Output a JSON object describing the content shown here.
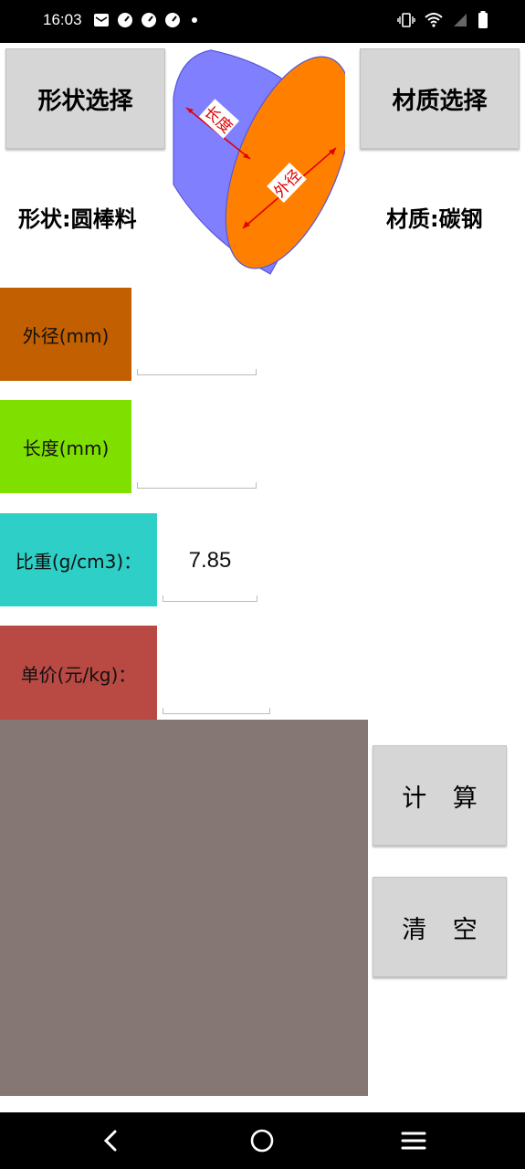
{
  "status_bar": {
    "time": "16:03",
    "left_icons": [
      "mail-icon",
      "speedometer-icon",
      "speedometer-icon",
      "speedometer-icon",
      "dot-icon"
    ],
    "right_icons": [
      "vibrate-icon",
      "wifi-icon",
      "signal-icon",
      "battery-icon"
    ]
  },
  "header": {
    "shape_button_label": "形状选择",
    "material_button_label": "材质选择",
    "shape_text": "形状:圆棒料",
    "material_text": "材质:碳钢"
  },
  "diagram": {
    "length_label": "长度",
    "diameter_label": "外径",
    "colors": {
      "side": "#8080ff",
      "face": "#ff8000",
      "arrow": "#e00000"
    }
  },
  "fields": {
    "outer_diameter": {
      "label": "外径(mm)",
      "value": ""
    },
    "length": {
      "label": "长度(mm)",
      "value": ""
    },
    "density": {
      "label": "比重(g/cm3)：",
      "value": "7.85"
    },
    "unit_price": {
      "label": "单价(元/kg)：",
      "value": ""
    }
  },
  "actions": {
    "calculate_label": "计 算",
    "clear_label": "清 空"
  },
  "colors": {
    "od_label_bg": "#c25f00",
    "length_label_bg": "#7fe000",
    "density_label_bg": "#2dcfc6",
    "price_label_bg": "#b84943",
    "result_bg": "#857773",
    "button_bg": "#d6d6d6"
  },
  "nav": {
    "icons": [
      "back-icon",
      "home-icon",
      "menu-icon"
    ]
  }
}
